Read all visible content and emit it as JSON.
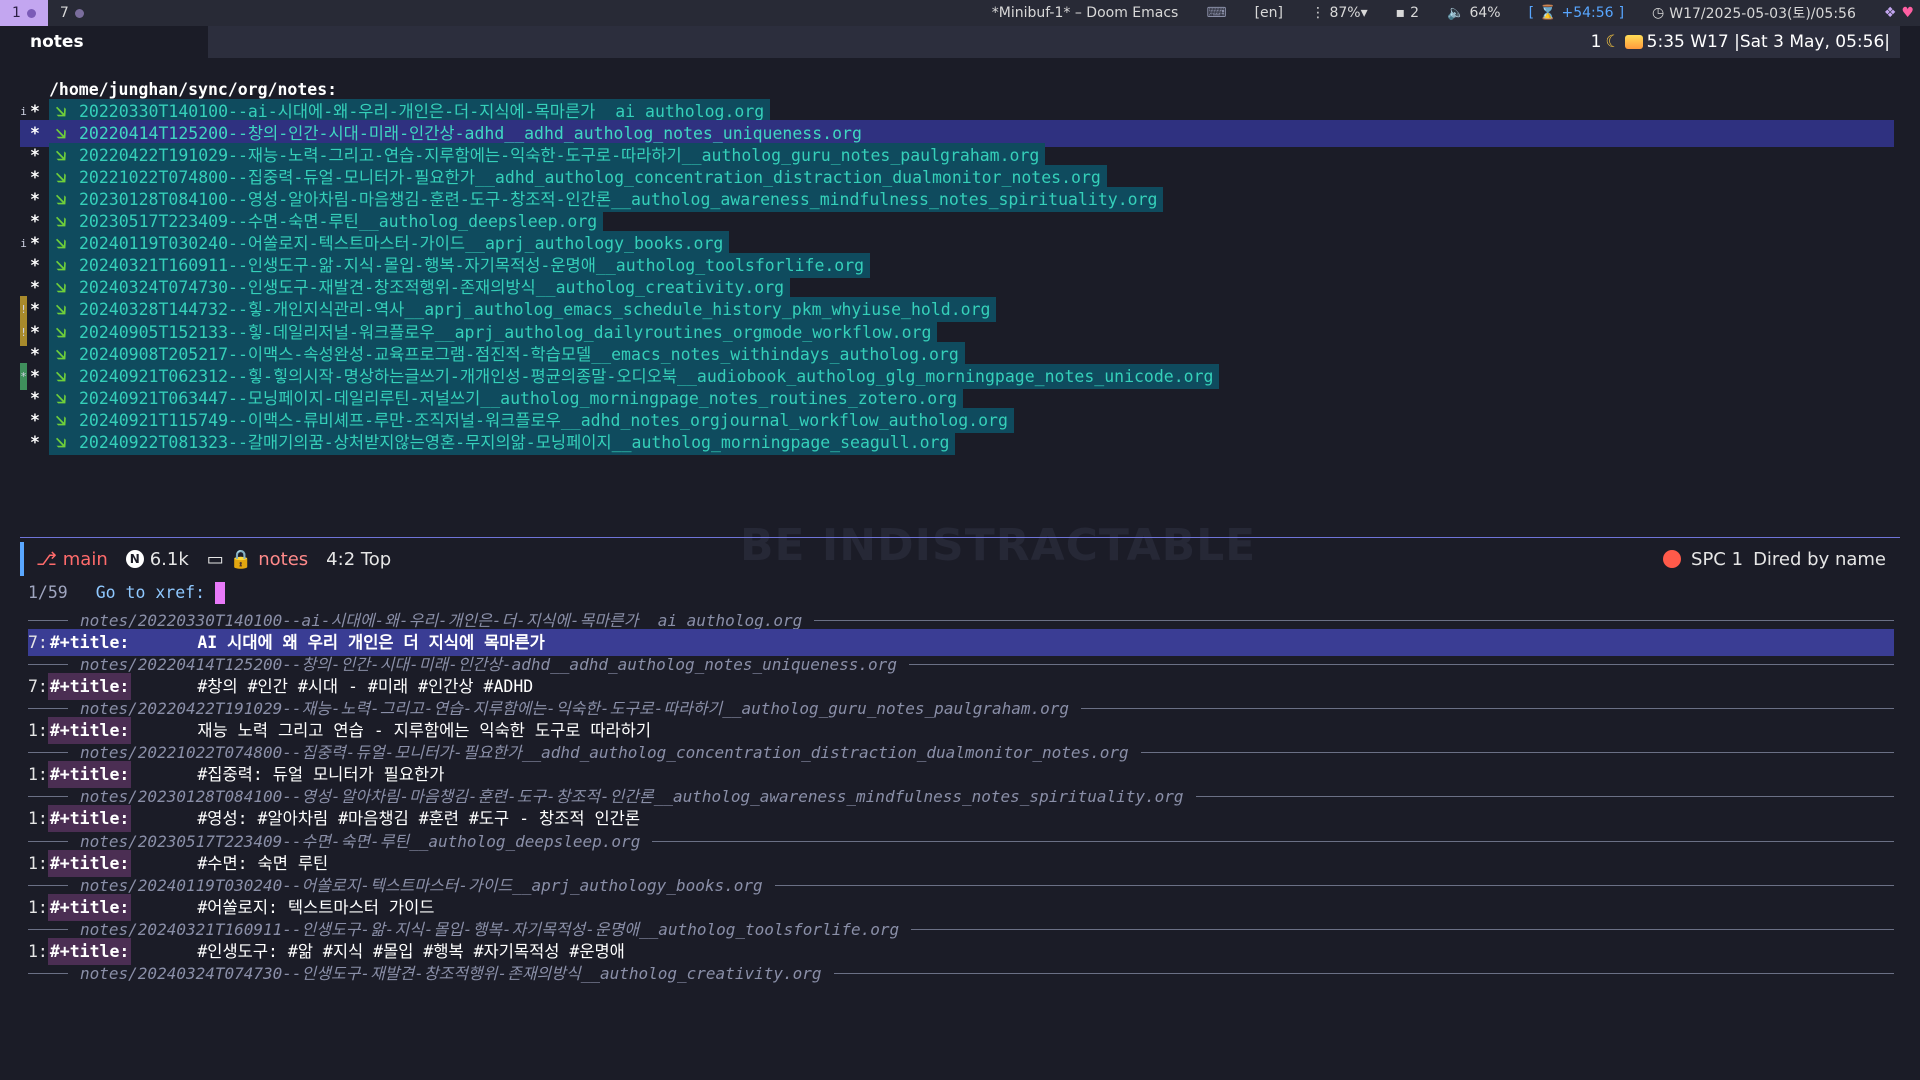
{
  "topbar": {
    "workspaces": [
      {
        "label": "1",
        "active": true
      },
      {
        "label": "7",
        "active": false
      }
    ],
    "window_title": "*Minibuf-1* – Doom Emacs",
    "keyboard_icon": "⌨",
    "lang": "[en]",
    "cpu": "⋮ 87%▾",
    "notifications": "2",
    "volume": "64%",
    "timer": "+54:56",
    "datetime": "W17/2025-05-03(토)/05:56",
    "colors": {
      "active_ws": "#c3a6f0",
      "accent": "#58a6ff"
    }
  },
  "tabline": {
    "active_tab": "notes",
    "right_prefix": "1",
    "right_text": "5:35 W17 |Sat  3 May, 05:56|"
  },
  "dired": {
    "header": "/home/junghan/sync/org/notes:",
    "rows": [
      {
        "fringe": "i",
        "mark": "*",
        "name": "20220330T140100--ai-시대에-왜-우리-개인은-더-지식에-목마른가__ai_autholog.org"
      },
      {
        "fringe": "",
        "mark": "*",
        "name": "20220414T125200--창의-인간-시대-미래-인간상-adhd__adhd_autholog_notes_uniqueness.org",
        "selected": true
      },
      {
        "fringe": "",
        "mark": "*",
        "name": "20220422T191029--재능-노력-그리고-연습-지루함에는-익숙한-도구로-따라하기__autholog_guru_notes_paulgraham.org"
      },
      {
        "fringe": "",
        "mark": "*",
        "name": "20221022T074800--집중력-듀얼-모니터가-필요한가__adhd_autholog_concentration_distraction_dualmonitor_notes.org"
      },
      {
        "fringe": "",
        "mark": "*",
        "name": "20230128T084100--영성-알아차림-마음챙김-훈련-도구-창조적-인간론__autholog_awareness_mindfulness_notes_spirituality.org"
      },
      {
        "fringe": "",
        "mark": "*",
        "name": "20230517T223409--수면-숙면-루틴__autholog_deepsleep.org"
      },
      {
        "fringe": "i",
        "mark": "*",
        "name": "20240119T030240--어쏠로지-텍스트마스터-가이드__aprj_authology_books.org"
      },
      {
        "fringe": "",
        "mark": "*",
        "name": "20240321T160911--인생도구-앎-지식-몰입-행복-자기목적성-운명애__autholog_toolsforlife.org"
      },
      {
        "fringe": "",
        "mark": "*",
        "name": "20240324T074730--인생도구-재발견-창조적행위-존재의방식__autholog_creativity.org"
      },
      {
        "fringe": "!",
        "fringe_color": "yellow",
        "mark": "*",
        "name": "20240328T144732--힣-개인지식관리-역사__aprj_autholog_emacs_schedule_history_pkm_whyiuse_hold.org"
      },
      {
        "fringe": "!",
        "fringe_color": "yellow",
        "mark": "*",
        "name": "20240905T152133--힣-데일리저널-워크플로우__aprj_autholog_dailyroutines_orgmode_workflow.org"
      },
      {
        "fringe": "",
        "mark": "*",
        "name": "20240908T205217--이맥스-속성완성-교육프로그램-점진적-학습모델__emacs_notes_withindays_autholog.org"
      },
      {
        "fringe": "*",
        "fringe_color": "green",
        "mark": "*",
        "name": "20240921T062312--힣-힣의시작-명상하는글쓰기-개개인성-평균의종말-오디오북__audiobook_autholog_glg_morningpage_notes_unicode.org"
      },
      {
        "fringe": "",
        "mark": "*",
        "name": "20240921T063447--모닝페이지-데일리루틴-저널쓰기__autholog_morningpage_notes_routines_zotero.org"
      },
      {
        "fringe": "",
        "mark": "*",
        "name": "20240921T115749--이맥스-류비셰프-루만-조직저널-워크플로우__adhd_notes_orgjournal_workflow_autholog.org"
      },
      {
        "fringe": "",
        "mark": "*",
        "name": "20240922T081323--갈매기의꿈-상처받지않는영혼-무지의앎-모닝페이지__autholog_morningpage_seagull.org"
      }
    ],
    "icon_glyph": "🡦",
    "watermark": "BE INDISTRACTABLE"
  },
  "modeline": {
    "branch": "main",
    "n_badge": "N",
    "size": "6.1k",
    "buffer": "notes",
    "position": "4:2 Top",
    "right_label": "SPC 1",
    "mode": "Dired by name"
  },
  "minibuffer": {
    "count": "1/59",
    "prompt": "Go to xref:",
    "groups": [
      {
        "file": "notes/20220330T140100--ai-시대에-왜-우리-개인은-더-지식에-목마른가__ai_autholog.org",
        "line": "7:",
        "keyword": "#+title:",
        "title": "AI 시대에 왜 우리 개인은 더 지식에 목마른가",
        "selected": true
      },
      {
        "file": "notes/20220414T125200--창의-인간-시대-미래-인간상-adhd__adhd_autholog_notes_uniqueness.org",
        "line": "7:",
        "keyword": "#+title:",
        "title": "#창의 #인간 #시대 - #미래 #인간상 #ADHD"
      },
      {
        "file": "notes/20220422T191029--재능-노력-그리고-연습-지루함에는-익숙한-도구로-따라하기__autholog_guru_notes_paulgraham.org",
        "line": "1:",
        "keyword": "#+title:",
        "title": "재능 노력 그리고 연습 - 지루함에는 익숙한 도구로 따라하기"
      },
      {
        "file": "notes/20221022T074800--집중력-듀얼-모니터가-필요한가__adhd_autholog_concentration_distraction_dualmonitor_notes.org",
        "line": "1:",
        "keyword": "#+title:",
        "title": "#집중력: 듀얼 모니터가 필요한가"
      },
      {
        "file": "notes/20230128T084100--영성-알아차림-마음챙김-훈련-도구-창조적-인간론__autholog_awareness_mindfulness_notes_spirituality.org",
        "line": "1:",
        "keyword": "#+title:",
        "title": "#영성: #알아차림 #마음챙김 #훈련 #도구 - 창조적 인간론"
      },
      {
        "file": "notes/20230517T223409--수면-숙면-루틴__autholog_deepsleep.org",
        "line": "1:",
        "keyword": "#+title:",
        "title": "#수면: 숙면 루틴"
      },
      {
        "file": "notes/20240119T030240--어쏠로지-텍스트마스터-가이드__aprj_authology_books.org",
        "line": "1:",
        "keyword": "#+title:",
        "title": "#어쏠로지: 텍스트마스터 가이드"
      },
      {
        "file": "notes/20240321T160911--인생도구-앎-지식-몰입-행복-자기목적성-운명애__autholog_toolsforlife.org",
        "line": "1:",
        "keyword": "#+title:",
        "title": "#인생도구: #앎 #지식 #몰입 #행복 #자기목적성 #운명애"
      }
    ],
    "last_file": "notes/20240324T074730--인생도구-재발견-창조적행위-존재의방식__autholog_creativity.org"
  }
}
